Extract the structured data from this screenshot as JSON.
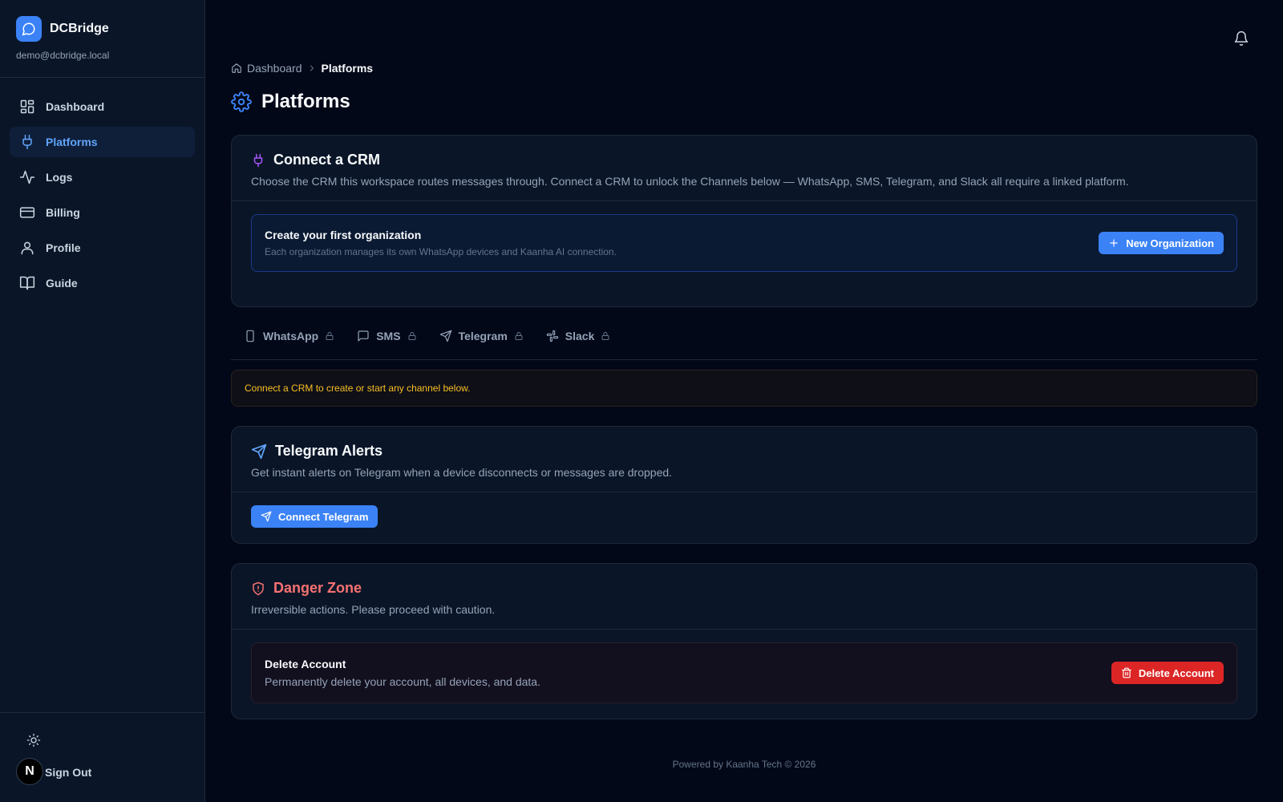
{
  "brand": {
    "name": "DCBridge",
    "email": "demo@dcbridge.local"
  },
  "sidebar": {
    "items": [
      {
        "label": "Dashboard",
        "icon": "layout-grid-icon"
      },
      {
        "label": "Platforms",
        "icon": "plug-icon",
        "active": true
      },
      {
        "label": "Logs",
        "icon": "activity-icon"
      },
      {
        "label": "Billing",
        "icon": "credit-card-icon"
      },
      {
        "label": "Profile",
        "icon": "user-icon"
      },
      {
        "label": "Guide",
        "icon": "book-open-icon"
      }
    ],
    "avatar_letter": "N",
    "sign_out": "Sign Out"
  },
  "breadcrumb": {
    "home": "Dashboard",
    "current": "Platforms"
  },
  "page": {
    "title": "Platforms"
  },
  "crm": {
    "title": "Connect a CRM",
    "description": "Choose the CRM this workspace routes messages through. Connect a CRM to unlock the Channels below — WhatsApp, SMS, Telegram, and Slack all require a linked platform.",
    "org_title": "Create your first organization",
    "org_desc": "Each organization manages its own WhatsApp devices and Kaanha AI connection.",
    "new_org_button": "New Organization"
  },
  "tabs": [
    {
      "label": "WhatsApp",
      "icon": "smartphone-icon",
      "locked": true
    },
    {
      "label": "SMS",
      "icon": "message-square-icon",
      "locked": true
    },
    {
      "label": "Telegram",
      "icon": "send-icon",
      "locked": true
    },
    {
      "label": "Slack",
      "icon": "slack-icon",
      "locked": true
    }
  ],
  "notice": "Connect a CRM to create or start any channel below.",
  "telegram": {
    "title": "Telegram Alerts",
    "description": "Get instant alerts on Telegram when a device disconnects or messages are dropped.",
    "button": "Connect Telegram"
  },
  "danger": {
    "title": "Danger Zone",
    "description": "Irreversible actions. Please proceed with caution.",
    "delete_title": "Delete Account",
    "delete_desc": "Permanently delete your account, all devices, and data.",
    "delete_button": "Delete Account"
  },
  "footer": "Powered by Kaanha Tech © 2026",
  "colors": {
    "accent": "#3b82f6",
    "danger": "#dc2626",
    "warning": "#fbbf24",
    "background": "#020817"
  }
}
